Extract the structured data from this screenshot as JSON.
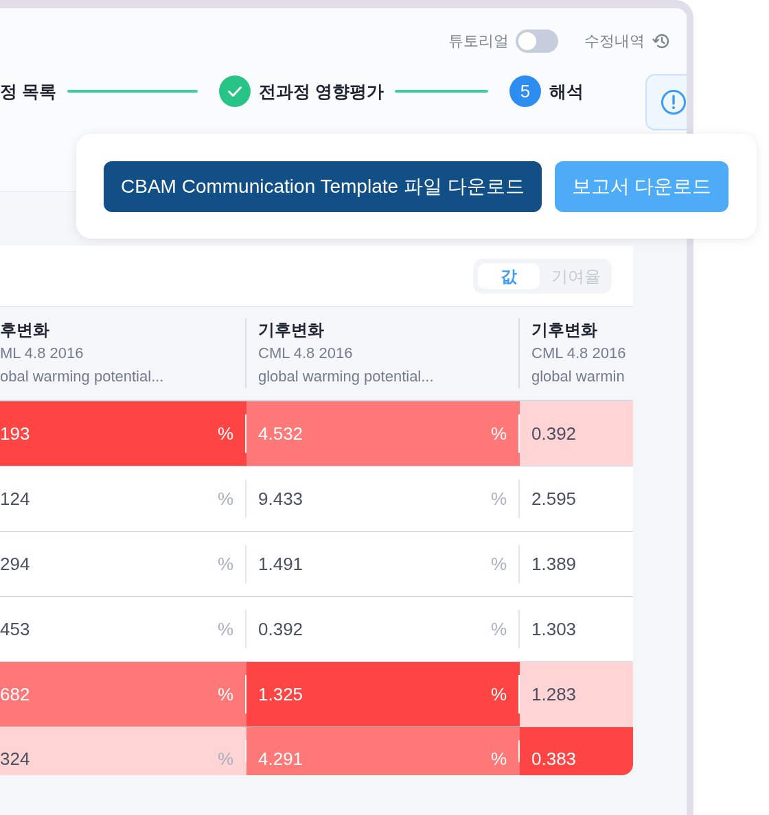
{
  "toolbar": {
    "tutorial": {
      "label": "튜토리얼",
      "on": false
    },
    "history": {
      "label": "수정내역"
    }
  },
  "steps": [
    {
      "label": "정 목록"
    },
    {
      "label": "전과정 영향평가",
      "done": true
    },
    {
      "label": "해석",
      "done": false,
      "number": "5"
    }
  ],
  "popup": {
    "buttons": [
      {
        "label": "CBAM Communication Template 파일 다운로드",
        "kind": "primary"
      },
      {
        "label": "보고서 다운로드",
        "kind": "secondary"
      }
    ]
  },
  "table": {
    "view_toggle": [
      {
        "label": "값",
        "selected": true
      },
      {
        "label": "기여율",
        "selected": false
      }
    ],
    "columns": [
      {
        "title": "후변화",
        "method": "ML 4.8 2016",
        "indicator": "obal warming potential..."
      },
      {
        "title": "기후변화",
        "method": "CML 4.8 2016",
        "indicator": "global warming potential..."
      },
      {
        "title": "기후변화",
        "method": "CML 4.8 2016",
        "indicator": "global warmin"
      }
    ],
    "rows": [
      {
        "cells": [
          {
            "value": "193",
            "unit": "%",
            "color": "#ff4444"
          },
          {
            "value": "4.532",
            "unit": "%",
            "color": "#ff7878"
          },
          {
            "value": "0.392",
            "color": "#ffd4d4"
          }
        ]
      },
      {
        "cells": [
          {
            "value": "124",
            "unit": "%",
            "color": "#ffffff"
          },
          {
            "value": "9.433",
            "unit": "%",
            "color": "#ffffff"
          },
          {
            "value": "2.595",
            "color": "#ffffff"
          }
        ]
      },
      {
        "cells": [
          {
            "value": "294",
            "unit": "%",
            "color": "#ffffff"
          },
          {
            "value": "1.491",
            "unit": "%",
            "color": "#ffffff"
          },
          {
            "value": "1.389",
            "color": "#ffffff"
          }
        ]
      },
      {
        "cells": [
          {
            "value": "453",
            "unit": "%",
            "color": "#ffffff"
          },
          {
            "value": "0.392",
            "unit": "%",
            "color": "#ffffff"
          },
          {
            "value": "1.303",
            "color": "#ffffff"
          }
        ]
      },
      {
        "cells": [
          {
            "value": "682",
            "unit": "%",
            "color": "#ff7878"
          },
          {
            "value": "1.325",
            "unit": "%",
            "color": "#ff4444"
          },
          {
            "value": "1.283",
            "color": "#ffd4d4"
          }
        ]
      },
      {
        "cells": [
          {
            "value": "324",
            "unit": "%",
            "color": "#ffd4d4"
          },
          {
            "value": "4.291",
            "unit": "%",
            "color": "#ff7878"
          },
          {
            "value": "0.383",
            "color": "#ff4444"
          }
        ]
      }
    ]
  }
}
